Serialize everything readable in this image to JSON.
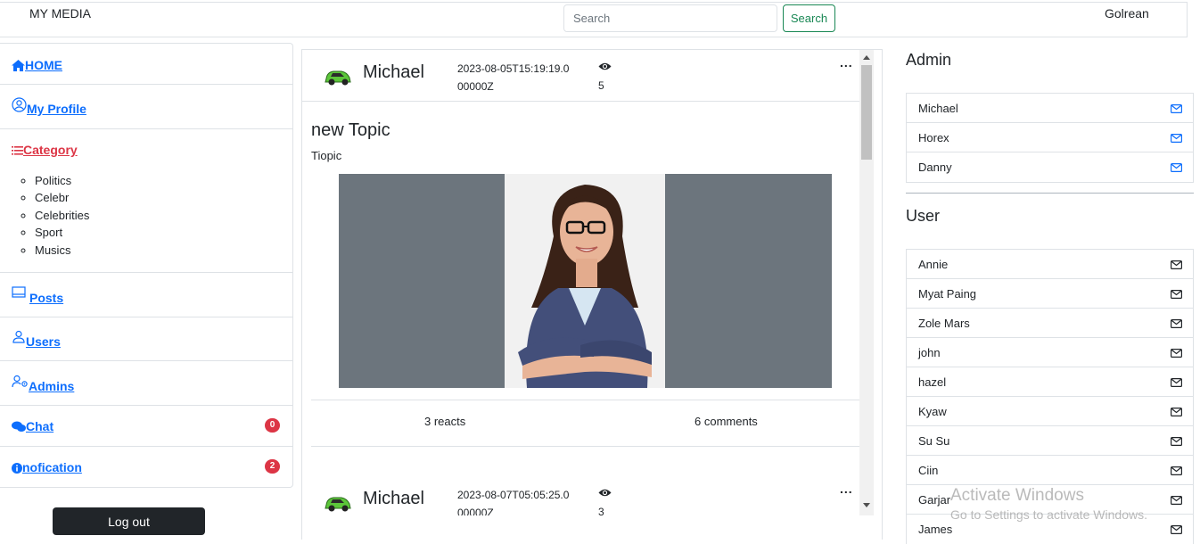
{
  "navbar": {
    "brand": "MY MEDIA",
    "search_placeholder": "Search",
    "search_button": "Search",
    "username": "Golrean"
  },
  "sidebar": {
    "home": "HOME",
    "profile": "My Profile",
    "category": "Category",
    "categories": [
      "Politics",
      "Celebr",
      "Celebrities",
      "Sport",
      "Musics"
    ],
    "posts": "Posts",
    "users": "Users",
    "admins": "Admins",
    "chat": "Chat",
    "chat_badge": "0",
    "notification": "nofication",
    "notification_badge": "2",
    "logout": "Log out"
  },
  "feed": {
    "posts": [
      {
        "author": "Michael",
        "date": "2023-08-05T15:19:19.000000Z",
        "views": "5",
        "more": "...",
        "title": "new Topic",
        "body": "Tiopic",
        "reacts": "3 reacts",
        "comments": "6 comments"
      },
      {
        "author": "Michael",
        "date": "2023-08-07T05:05:25.000000Z",
        "views": "3",
        "more": "..."
      }
    ]
  },
  "right": {
    "admin_title": "Admin",
    "admins": [
      "Michael",
      "Horex",
      "Danny"
    ],
    "user_title": "User",
    "users": [
      "Annie",
      "Myat Paing",
      "Zole Mars",
      "john",
      "hazel",
      "Kyaw",
      "Su Su",
      "Ciin",
      "Garjar",
      "James"
    ]
  },
  "watermark": {
    "line1": "Activate Windows",
    "line2": "Go to Settings to activate Windows."
  },
  "colors": {
    "link": "#0d6efd",
    "category": "#dc3545",
    "badge": "#dc3545",
    "search_outline": "#198754",
    "admin_mail": "#0d6efd",
    "logout_bg": "#212529"
  }
}
